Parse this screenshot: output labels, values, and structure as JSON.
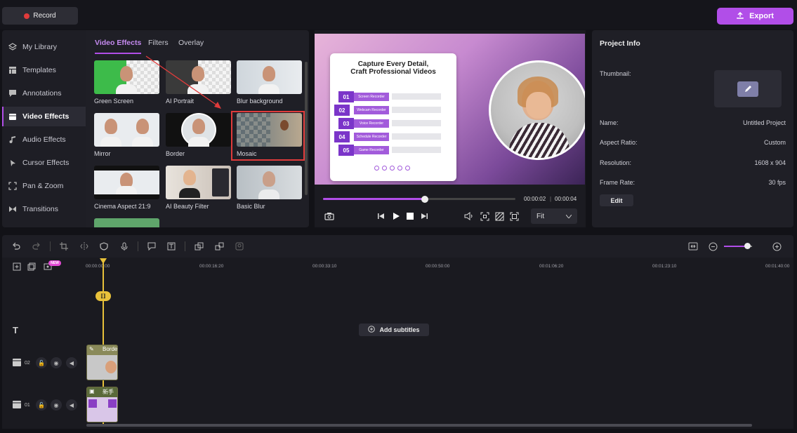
{
  "top": {
    "record_label": "Record",
    "export_label": "Export"
  },
  "sidebar": {
    "items": [
      {
        "label": "My Library",
        "icon": "layers-icon"
      },
      {
        "label": "Templates",
        "icon": "template-icon"
      },
      {
        "label": "Annotations",
        "icon": "annotation-icon"
      },
      {
        "label": "Video Effects",
        "icon": "video-effects-icon",
        "active": true
      },
      {
        "label": "Audio Effects",
        "icon": "music-icon"
      },
      {
        "label": "Cursor Effects",
        "icon": "cursor-icon"
      },
      {
        "label": "Pan & Zoom",
        "icon": "pan-zoom-icon"
      },
      {
        "label": "Transitions",
        "icon": "transition-icon"
      }
    ]
  },
  "effects": {
    "tabs": [
      "Video Effects",
      "Filters",
      "Overlay"
    ],
    "items": [
      {
        "label": "Green Screen"
      },
      {
        "label": "AI Portrait"
      },
      {
        "label": "Blur background"
      },
      {
        "label": "Mirror"
      },
      {
        "label": "Border"
      },
      {
        "label": "Mosaic",
        "highlighted": true
      },
      {
        "label": "Cinema Aspect 21:9"
      },
      {
        "label": "AI Beauty Filter"
      },
      {
        "label": "Basic Blur"
      }
    ]
  },
  "preview": {
    "slide_title_1": "Capture Every Detail,",
    "slide_title_2": "Craft Professional Videos",
    "slide_rows": [
      {
        "num": "01",
        "tag": "Screen Recorder"
      },
      {
        "num": "02",
        "tag": "Webcam Recorder"
      },
      {
        "num": "03",
        "tag": "Voice Recorder"
      },
      {
        "num": "04",
        "tag": "Schedule Recorder"
      },
      {
        "num": "05",
        "tag": "Game Recorder"
      }
    ],
    "current_time": "00:00:02",
    "total_time": "00:00:04",
    "progress": 0.53,
    "fit_label": "Fit"
  },
  "project_info": {
    "title": "Project Info",
    "thumbnail_label": "Thumbnail:",
    "fields": [
      {
        "label": "Name:",
        "value": "Untitled Project"
      },
      {
        "label": "Aspect Ratio:",
        "value": "Custom"
      },
      {
        "label": "Resolution:",
        "value": "1608 x 904"
      },
      {
        "label": "Frame Rate:",
        "value": "30 fps"
      }
    ],
    "edit_label": "Edit"
  },
  "timeline": {
    "ruler": [
      "00:00:00:00",
      "00:00:16:20",
      "00:00:33:10",
      "00:00:50:00",
      "00:01:06:20",
      "00:01:23:10",
      "00:01:40:00"
    ],
    "new_badge": "NEW",
    "add_subtitles_label": "Add subtitles",
    "track_02": "02",
    "track_01": "01",
    "clip_02_label": "Borde",
    "clip_01_label": "新手",
    "text_track_icon": "T"
  },
  "colors": {
    "accent": "#b14ee8",
    "playhead": "#e8c13a",
    "highlight_box": "#e03b3b"
  }
}
